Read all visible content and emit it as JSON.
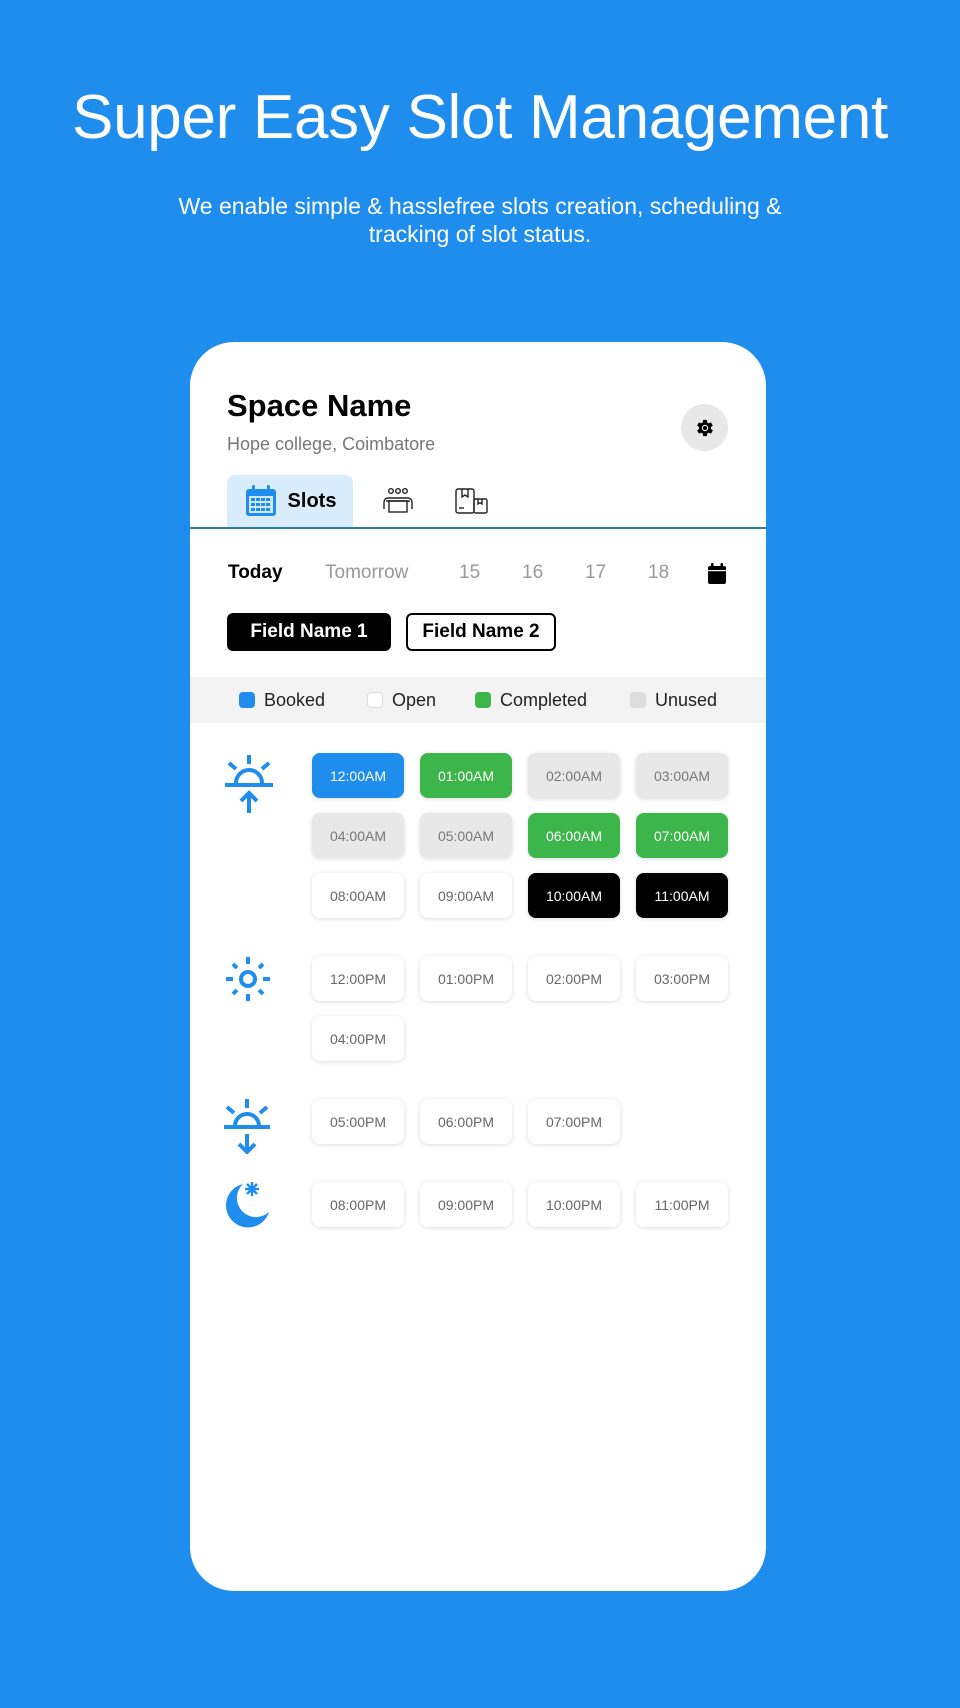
{
  "hero": {
    "title": "Super Easy Slot Management",
    "subtitle": "We enable simple & hasslefree slots creation, scheduling & tracking of slot status."
  },
  "space": {
    "name": "Space Name",
    "location": "Hope college, Coimbatore",
    "settings_icon": "gear-icon"
  },
  "tabs": [
    {
      "label": "Slots",
      "icon": "calendar-icon",
      "active": true
    },
    {
      "label": "",
      "icon": "people-group-icon",
      "active": false
    },
    {
      "label": "",
      "icon": "package-boxes-icon",
      "active": false
    }
  ],
  "dates": [
    {
      "label": "Today",
      "active": true
    },
    {
      "label": "Tomorrow",
      "active": false
    },
    {
      "label": "15",
      "active": false
    },
    {
      "label": "16",
      "active": false
    },
    {
      "label": "17",
      "active": false
    },
    {
      "label": "18",
      "active": false
    }
  ],
  "date_picker_icon": "calendar-icon",
  "fields": [
    {
      "label": "Field Name 1",
      "active": true
    },
    {
      "label": "Field Name 2",
      "active": false
    }
  ],
  "legend": [
    {
      "label": "Booked",
      "color": "#1e8ded"
    },
    {
      "label": "Open",
      "color": "#ffffff"
    },
    {
      "label": "Completed",
      "color": "#3cb54a"
    },
    {
      "label": "Unused",
      "color": "#dddddd"
    }
  ],
  "slot_groups": [
    {
      "name": "morning",
      "icon": "sunrise-icon",
      "slots": [
        {
          "time": "12:00AM",
          "status": "booked"
        },
        {
          "time": "01:00AM",
          "status": "completed"
        },
        {
          "time": "02:00AM",
          "status": "unused"
        },
        {
          "time": "03:00AM",
          "status": "unused"
        },
        {
          "time": "04:00AM",
          "status": "unused"
        },
        {
          "time": "05:00AM",
          "status": "unused"
        },
        {
          "time": "06:00AM",
          "status": "completed"
        },
        {
          "time": "07:00AM",
          "status": "completed"
        },
        {
          "time": "08:00AM",
          "status": "open"
        },
        {
          "time": "09:00AM",
          "status": "open"
        },
        {
          "time": "10:00AM",
          "status": "selected"
        },
        {
          "time": "11:00AM",
          "status": "selected"
        }
      ]
    },
    {
      "name": "afternoon",
      "icon": "sun-icon",
      "slots": [
        {
          "time": "12:00PM",
          "status": "open"
        },
        {
          "time": "01:00PM",
          "status": "open"
        },
        {
          "time": "02:00PM",
          "status": "open"
        },
        {
          "time": "03:00PM",
          "status": "open"
        },
        {
          "time": "04:00PM",
          "status": "open"
        }
      ]
    },
    {
      "name": "evening",
      "icon": "sunset-icon",
      "slots": [
        {
          "time": "05:00PM",
          "status": "open"
        },
        {
          "time": "06:00PM",
          "status": "open"
        },
        {
          "time": "07:00PM",
          "status": "open"
        }
      ]
    },
    {
      "name": "night",
      "icon": "moon-icon",
      "slots": [
        {
          "time": "08:00PM",
          "status": "open"
        },
        {
          "time": "09:00PM",
          "status": "open"
        },
        {
          "time": "10:00PM",
          "status": "open"
        },
        {
          "time": "11:00PM",
          "status": "open"
        }
      ]
    }
  ]
}
